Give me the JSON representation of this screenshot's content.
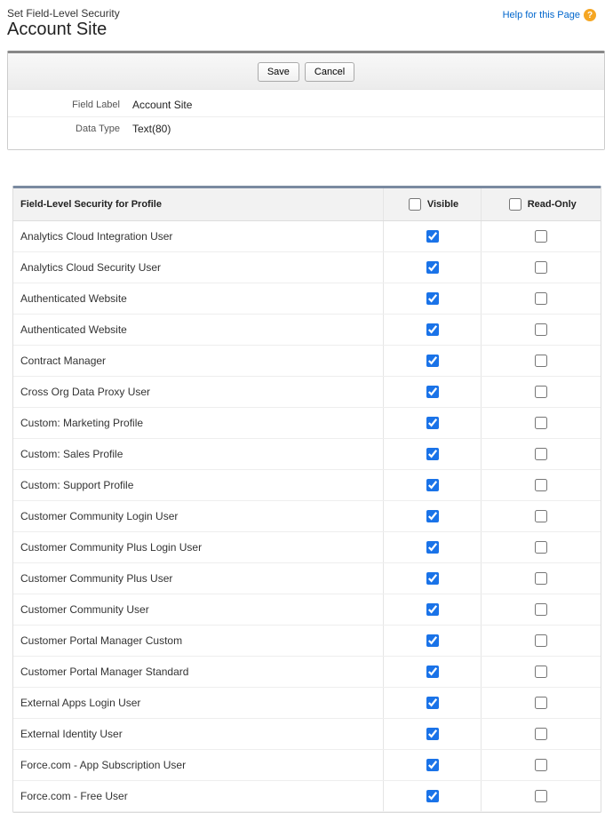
{
  "header": {
    "subtitle": "Set Field-Level Security",
    "title": "Account Site",
    "help_link": "Help for this Page",
    "help_icon_text": "?"
  },
  "buttons": {
    "save": "Save",
    "cancel": "Cancel"
  },
  "details": {
    "field_label_key": "Field Label",
    "field_label_value": "Account Site",
    "data_type_key": "Data Type",
    "data_type_value": "Text(80)"
  },
  "table": {
    "col_profile": "Field-Level Security for Profile",
    "col_visible": "Visible",
    "col_readonly": "Read-Only",
    "header_visible_checked": false,
    "header_readonly_checked": false,
    "rows": [
      {
        "profile": "Analytics Cloud Integration User",
        "visible": true,
        "readonly": false
      },
      {
        "profile": "Analytics Cloud Security User",
        "visible": true,
        "readonly": false
      },
      {
        "profile": "Authenticated Website",
        "visible": true,
        "readonly": false
      },
      {
        "profile": "Authenticated Website",
        "visible": true,
        "readonly": false
      },
      {
        "profile": "Contract Manager",
        "visible": true,
        "readonly": false
      },
      {
        "profile": "Cross Org Data Proxy User",
        "visible": true,
        "readonly": false
      },
      {
        "profile": "Custom: Marketing Profile",
        "visible": true,
        "readonly": false
      },
      {
        "profile": "Custom: Sales Profile",
        "visible": true,
        "readonly": false
      },
      {
        "profile": "Custom: Support Profile",
        "visible": true,
        "readonly": false
      },
      {
        "profile": "Customer Community Login User",
        "visible": true,
        "readonly": false
      },
      {
        "profile": "Customer Community Plus Login User",
        "visible": true,
        "readonly": false
      },
      {
        "profile": "Customer Community Plus User",
        "visible": true,
        "readonly": false
      },
      {
        "profile": "Customer Community User",
        "visible": true,
        "readonly": false
      },
      {
        "profile": "Customer Portal Manager Custom",
        "visible": true,
        "readonly": false
      },
      {
        "profile": "Customer Portal Manager Standard",
        "visible": true,
        "readonly": false
      },
      {
        "profile": "External Apps Login User",
        "visible": true,
        "readonly": false
      },
      {
        "profile": "External Identity User",
        "visible": true,
        "readonly": false
      },
      {
        "profile": "Force.com - App Subscription User",
        "visible": true,
        "readonly": false
      },
      {
        "profile": "Force.com - Free User",
        "visible": true,
        "readonly": false
      }
    ]
  }
}
